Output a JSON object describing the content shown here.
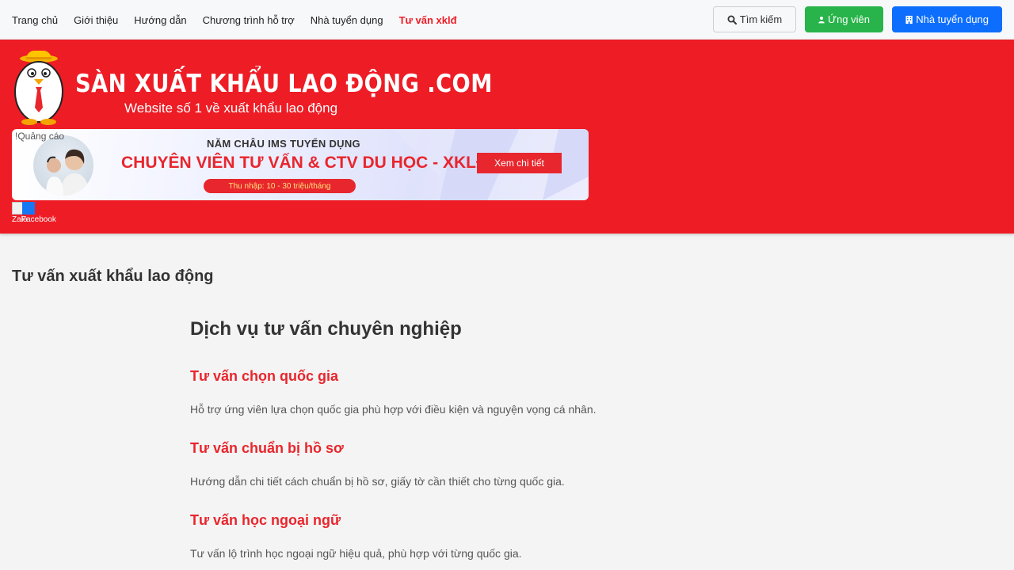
{
  "nav": {
    "links": [
      {
        "label": "Trang chủ"
      },
      {
        "label": "Giới thiệu"
      },
      {
        "label": "Hướng dẫn"
      },
      {
        "label": "Chương trình hỗ trợ"
      },
      {
        "label": "Nhà tuyển dụng"
      },
      {
        "label": "Tư vấn xklđ",
        "active": true
      }
    ],
    "search_label": "Tìm kiếm",
    "candidate_label": "Ứng viên",
    "employer_label": "Nhà tuyển dụng"
  },
  "header": {
    "logo_title": "SÀN XUẤT KHẨU LAO ĐỘNG .COM",
    "logo_subtitle": "Website số 1 về xuất khẩu lao động",
    "ad_label": "!Quảng cáo",
    "banner": {
      "title1": "NĂM CHÂU IMS TUYỂN DỤNG",
      "title2": "CHUYÊN VIÊN TƯ VẤN & CTV DU HỌC - XKLĐ",
      "income": "Thu nhập: 10 - 30 triệu/tháng",
      "cta": "Xem chi tiết"
    },
    "social": {
      "zalo_label": "Zalo",
      "facebook_label": "Facebook"
    }
  },
  "colors": {
    "brand_red": "#ee1c25",
    "accent_red": "#e8262d",
    "green": "#28b44a",
    "blue": "#0d6efd"
  },
  "main": {
    "page_title": "Tư vấn xuất khẩu lao động",
    "section_title": "Dịch vụ tư vấn chuyên nghiệp",
    "items": [
      {
        "title": "Tư vấn chọn quốc gia",
        "desc": "Hỗ trợ ứng viên lựa chọn quốc gia phù hợp với điều kiện và nguyện vọng cá nhân."
      },
      {
        "title": "Tư vấn chuẩn bị hồ sơ",
        "desc": "Hướng dẫn chi tiết cách chuẩn bị hồ sơ, giấy tờ cần thiết cho từng quốc gia."
      },
      {
        "title": "Tư vấn học ngoại ngữ",
        "desc": "Tư vấn lộ trình học ngoại ngữ hiệu quả, phù hợp với từng quốc gia."
      }
    ]
  }
}
